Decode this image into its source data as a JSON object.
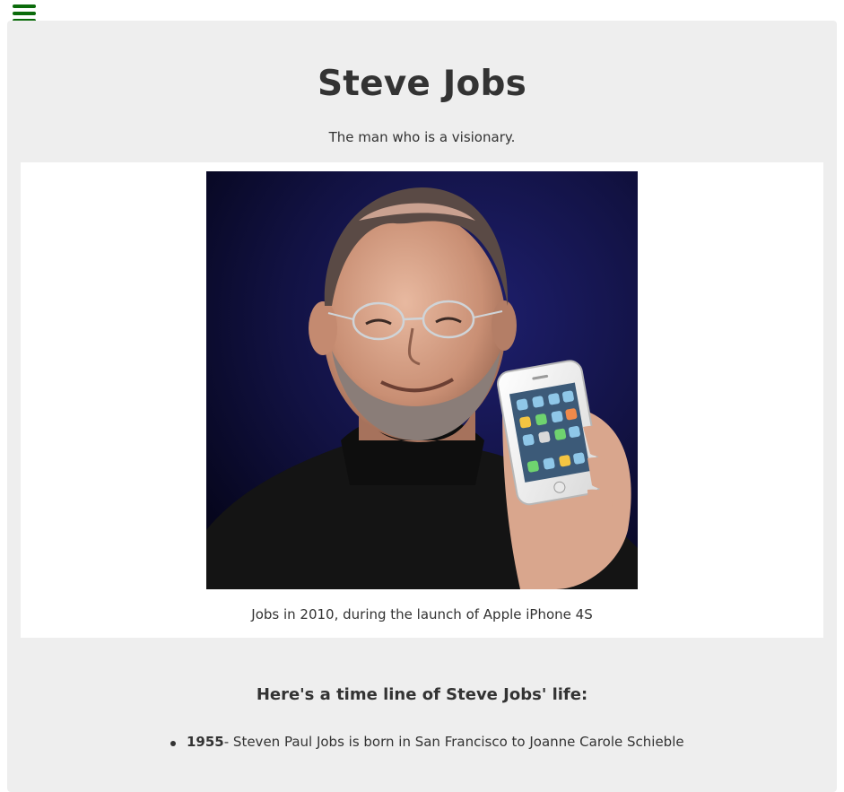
{
  "nav": {
    "menu_icon": "hamburger-menu-icon",
    "menu_color": "#0b6b0b"
  },
  "header": {
    "title": "Steve Jobs",
    "subtitle": "The man who is a visionary."
  },
  "image": {
    "caption": "Jobs in 2010, during the launch of Apple iPhone 4S"
  },
  "timeline": {
    "heading": "Here's a time line of Steve Jobs' life:",
    "items": [
      {
        "year": "1955",
        "text": "- Steven Paul Jobs is born in San Francisco to Joanne Carole Schieble"
      }
    ]
  },
  "colors": {
    "page_background": "#eeeeee",
    "image_panel_background": "#ffffff",
    "text": "#333333"
  }
}
